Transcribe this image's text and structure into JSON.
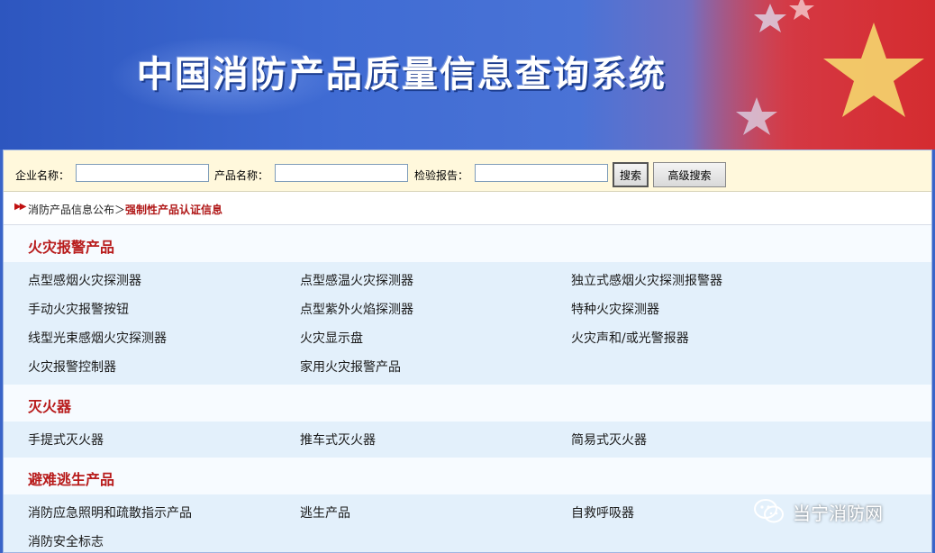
{
  "banner": {
    "title": "中国消防产品质量信息查询系统"
  },
  "search": {
    "company_label": "企业名称：",
    "product_label": "产品名称：",
    "report_label": "检验报告：",
    "company_value": "",
    "product_value": "",
    "report_value": "",
    "search_button": "搜索",
    "advanced_button": "高级搜索"
  },
  "breadcrumb": {
    "parent": "消防产品信息公布＞",
    "current": "强制性产品认证信息"
  },
  "categories": [
    {
      "title": "火灾报警产品",
      "rows": [
        [
          "点型感烟火灾探测器",
          "点型感温火灾探测器",
          "独立式感烟火灾探测报警器"
        ],
        [
          "手动火灾报警按钮",
          "点型紫外火焰探测器",
          "特种火灾探测器"
        ],
        [
          "线型光束感烟火灾探测器",
          "火灾显示盘",
          "火灾声和/或光警报器"
        ],
        [
          "火灾报警控制器",
          "家用火灾报警产品",
          ""
        ]
      ]
    },
    {
      "title": "灭火器",
      "rows": [
        [
          "手提式灭火器",
          "推车式灭火器",
          "简易式灭火器"
        ]
      ]
    },
    {
      "title": "避难逃生产品",
      "rows": [
        [
          "消防应急照明和疏散指示产品",
          "逃生产品",
          "自救呼吸器"
        ],
        [
          "消防安全标志",
          "",
          ""
        ]
      ]
    }
  ],
  "watermark": {
    "text": "当宁消防网",
    "icon": "wechat-icon"
  },
  "colors": {
    "category_title": "#b81c1c",
    "breadcrumb_current": "#b01818",
    "search_bar_bg": "#fff8dc",
    "list_bg": "#e3f0fb"
  }
}
